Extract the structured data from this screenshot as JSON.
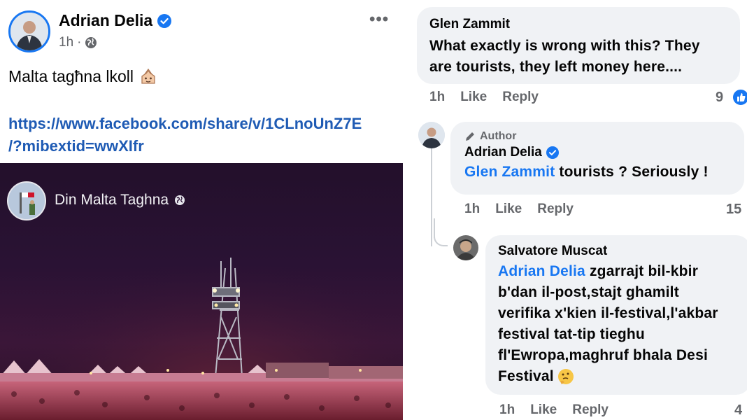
{
  "post": {
    "author": "Adrian Delia",
    "time": "1h",
    "more_label": "•••",
    "text": "Malta tagħna lkoll",
    "link_line1": "https://www.facebook.com/share/v/1CLnoUnZ7E",
    "link_line2": "/?mibextid=wwXIfr",
    "shared_page": "Din Malta Taghna"
  },
  "comments": [
    {
      "author": "Glen Zammit",
      "text_line1": "What exactly is wrong with this? They",
      "text_line2": "are tourists, they left money here....",
      "time": "1h",
      "like_label": "Like",
      "reply_label": "Reply",
      "reaction_count": "9"
    },
    {
      "author_badge": "Author",
      "author": "Adrian Delia",
      "mention": "Glen Zammit",
      "text": " tourists ? Seriously !",
      "time": "1h",
      "like_label": "Like",
      "reply_label": "Reply",
      "reaction_count": "15"
    },
    {
      "author": "Salvatore Muscat",
      "mention": "Adrian Delia",
      "text_line1": " zgarrajt bil-kbir",
      "text_line2": "b'dan il-post,stajt ghamilt",
      "text_line3": "verifika x'kien il-festival,l'akbar",
      "text_line4": "festival tat-tip tieghu",
      "text_line5": "fl'Ewropa,maghruf bhala Desi",
      "text_line6": "Festival",
      "time": "1h",
      "like_label": "Like",
      "reply_label": "Reply",
      "reaction_count": "4"
    }
  ],
  "colors": {
    "accent": "#1877f2",
    "link": "#1f5bb4",
    "bubble": "#f0f2f5",
    "secondary_text": "#65676b"
  },
  "icons": [
    "verified-badge-icon",
    "globe-icon",
    "more-options-icon",
    "emoji-icon",
    "pen-icon",
    "thinking-emoji-icon",
    "like-reaction-icon"
  ]
}
